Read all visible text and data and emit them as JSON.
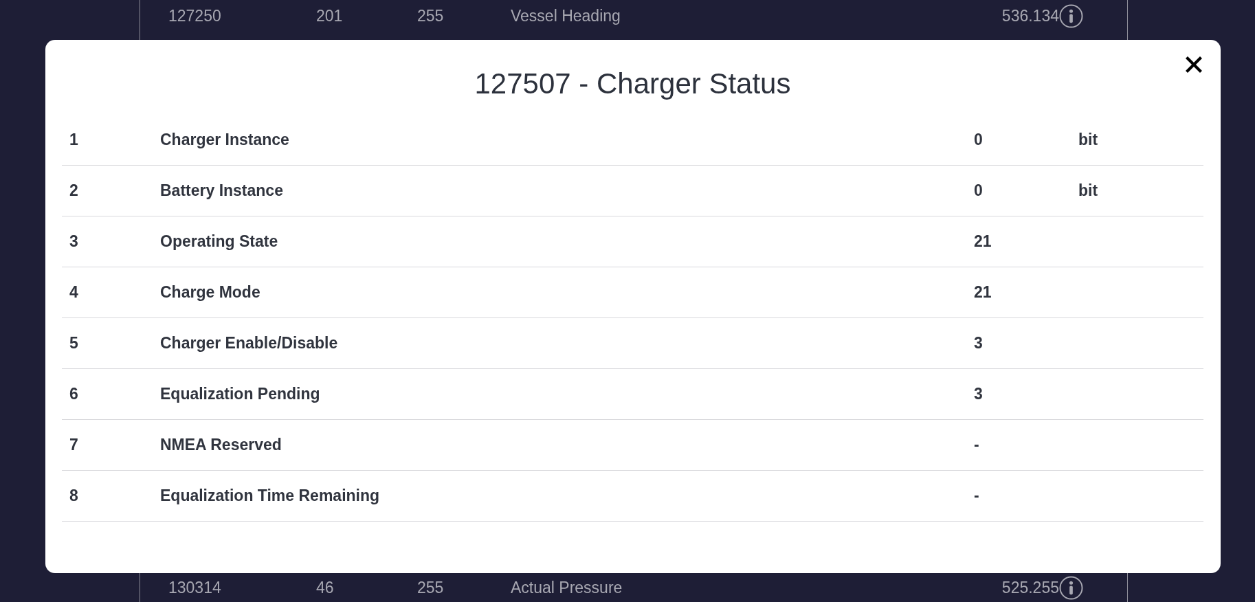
{
  "background_table": {
    "rows": [
      {
        "cells": [
          "127250",
          "201",
          "255",
          "Vessel Heading",
          "536.134"
        ]
      },
      {
        "cells": [
          "130314",
          "46",
          "255",
          "Actual Pressure",
          "525.255"
        ]
      }
    ]
  },
  "dialog": {
    "title": "127507 - Charger Status",
    "rows": [
      {
        "cells": [
          "1",
          "Charger Instance",
          "0",
          "bit"
        ]
      },
      {
        "cells": [
          "2",
          "Battery Instance",
          "0",
          "bit"
        ]
      },
      {
        "cells": [
          "3",
          "Operating State",
          "21"
        ]
      },
      {
        "cells": [
          "4",
          "Charge Mode",
          "21"
        ]
      },
      {
        "cells": [
          "5",
          "Charger Enable/Disable",
          "3"
        ]
      },
      {
        "cells": [
          "6",
          "Equalization Pending",
          "3"
        ]
      },
      {
        "cells": [
          "7",
          "NMEA Reserved",
          "-"
        ]
      },
      {
        "cells": [
          "8",
          "Equalization Time Remaining",
          "-"
        ]
      }
    ]
  }
}
